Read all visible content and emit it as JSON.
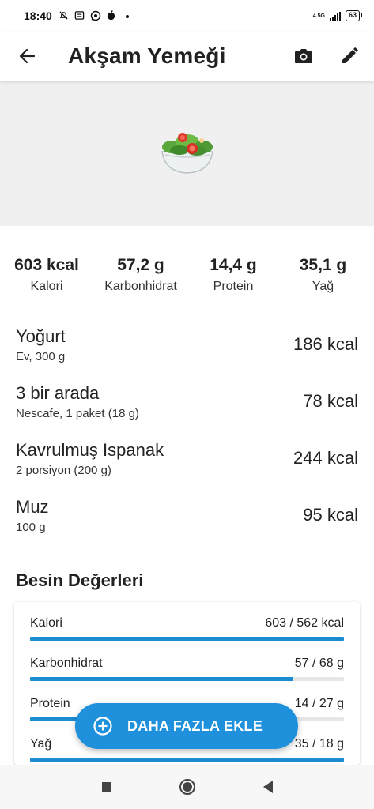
{
  "status_bar": {
    "time": "18:40",
    "network": "4.5G",
    "battery": "63"
  },
  "app_bar": {
    "title": "Akşam Yemeği"
  },
  "summary": [
    {
      "value": "603 kcal",
      "label": "Kalori"
    },
    {
      "value": "57,2 g",
      "label": "Karbonhidrat"
    },
    {
      "value": "14,4 g",
      "label": "Protein"
    },
    {
      "value": "35,1 g",
      "label": "Yağ"
    }
  ],
  "foods": [
    {
      "name": "Yoğurt",
      "detail": "Ev, 300 g",
      "kcal": "186 kcal"
    },
    {
      "name": "3 bir arada",
      "detail": "Nescafe, 1 paket (18 g)",
      "kcal": "78 kcal"
    },
    {
      "name": "Kavrulmuş Ispanak",
      "detail": "2 porsiyon (200 g)",
      "kcal": "244 kcal"
    },
    {
      "name": "Muz",
      "detail": "100 g",
      "kcal": "95 kcal"
    }
  ],
  "nutrients_section": {
    "title": "Besin Değerleri",
    "rows": [
      {
        "label": "Kalori",
        "amount": "603 / 562 kcal",
        "progress": 1.0
      },
      {
        "label": "Karbonhidrat",
        "amount": "57 / 68 g",
        "progress": 0.84
      },
      {
        "label": "Protein",
        "amount": "14 / 27 g",
        "progress": 0.52
      },
      {
        "label": "Yağ",
        "amount": "35 / 18 g",
        "progress": 1.0
      }
    ]
  },
  "fab": {
    "label": "DAHA FAZLA EKLE"
  },
  "colors": {
    "accent": "#1e90dc",
    "progress": "#1a8ccf"
  }
}
